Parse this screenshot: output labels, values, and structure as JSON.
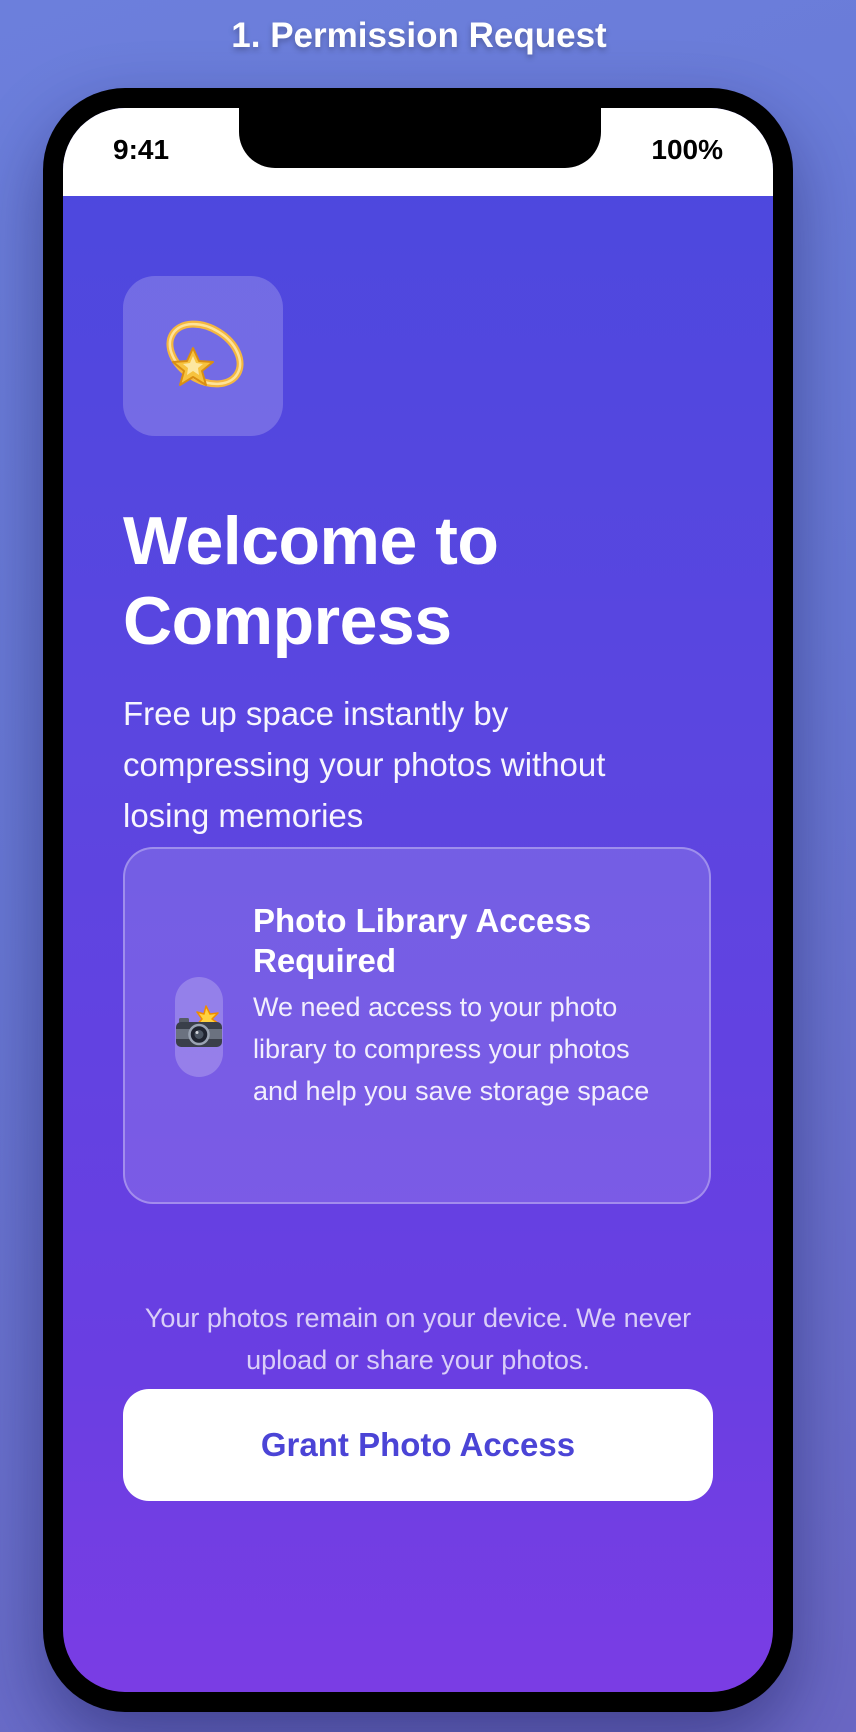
{
  "screen_title": "1. Permission Request",
  "status_bar": {
    "time": "9:41",
    "battery": "100%"
  },
  "app_icon": {
    "icon": "dizzy-star-icon"
  },
  "welcome": {
    "title": "Welcome to Compress",
    "subtitle": "Free up space instantly by compressing your photos without losing memories"
  },
  "permission_card": {
    "icon": "camera-flash-icon",
    "title": "Photo Library Access Required",
    "description": "We need access to your photo library to compress your photos and help you save storage space"
  },
  "privacy_note": "Your photos remain on your device. We never upload or share your photos.",
  "primary_action": {
    "label": "Grant Photo Access"
  },
  "colors": {
    "page_background": "#6c7fdc",
    "screen_gradient_top": "#4b48de",
    "screen_gradient_bottom": "#7a3de4",
    "button_text": "#4b44d6",
    "button_background": "#ffffff"
  }
}
